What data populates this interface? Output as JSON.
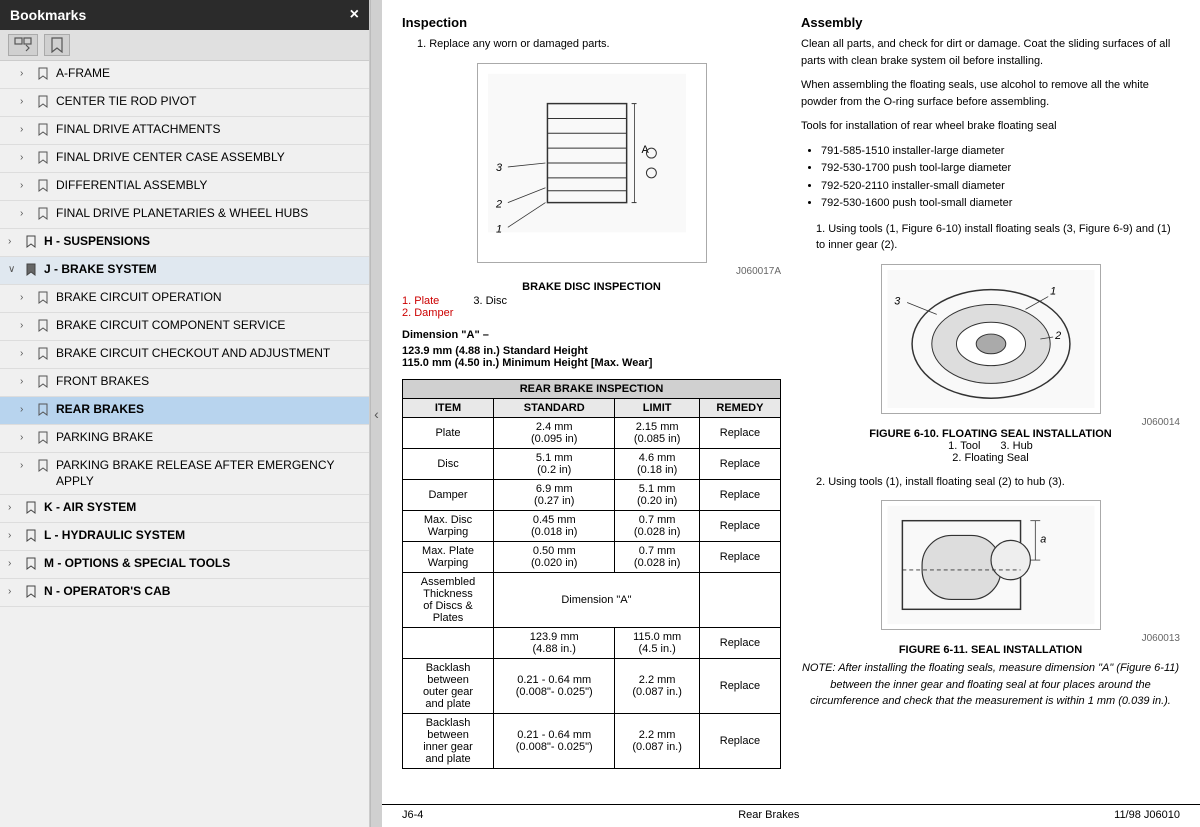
{
  "sidebar": {
    "title": "Bookmarks",
    "close_label": "×",
    "toolbar": {
      "btn1": "▤▼",
      "btn2": "🔖"
    },
    "items": [
      {
        "id": "a-frame",
        "label": "A-FRAME",
        "level": 1,
        "indent": 1,
        "expanded": false,
        "selected": false,
        "hasArrow": true
      },
      {
        "id": "center-tie-rod",
        "label": "CENTER TIE ROD PIVOT",
        "level": 1,
        "indent": 1,
        "expanded": false,
        "selected": false,
        "hasArrow": true
      },
      {
        "id": "final-drive-attach",
        "label": "FINAL DRIVE ATTACHMENTS",
        "level": 1,
        "indent": 1,
        "expanded": false,
        "selected": false,
        "hasArrow": true
      },
      {
        "id": "final-drive-center",
        "label": "FINAL DRIVE CENTER CASE ASSEMBLY",
        "level": 1,
        "indent": 1,
        "expanded": false,
        "selected": false,
        "hasArrow": true
      },
      {
        "id": "differential",
        "label": "DIFFERENTIAL ASSEMBLY",
        "level": 1,
        "indent": 1,
        "expanded": false,
        "selected": false,
        "hasArrow": true
      },
      {
        "id": "final-drive-planetaries",
        "label": "FINAL DRIVE PLANETARIES & WHEEL HUBS",
        "level": 1,
        "indent": 1,
        "expanded": false,
        "selected": false,
        "hasArrow": true
      },
      {
        "id": "h-suspensions",
        "label": "H - SUSPENSIONS",
        "level": 0,
        "indent": 0,
        "expanded": false,
        "selected": false,
        "hasArrow": true
      },
      {
        "id": "j-brake-system",
        "label": "J - BRAKE SYSTEM",
        "level": 0,
        "indent": 0,
        "expanded": true,
        "selected": false,
        "hasArrow": true,
        "isExpanded": true
      },
      {
        "id": "brake-circuit-op",
        "label": "BRAKE CIRCUIT OPERATION",
        "level": 1,
        "indent": 1,
        "expanded": false,
        "selected": false,
        "hasArrow": true
      },
      {
        "id": "brake-circuit-comp",
        "label": "BRAKE CIRCUIT COMPONENT SERVICE",
        "level": 1,
        "indent": 1,
        "expanded": false,
        "selected": false,
        "hasArrow": true
      },
      {
        "id": "brake-circuit-checkout",
        "label": "BRAKE CIRCUIT CHECKOUT AND ADJUSTMENT",
        "level": 1,
        "indent": 1,
        "expanded": false,
        "selected": false,
        "hasArrow": true
      },
      {
        "id": "front-brakes",
        "label": "FRONT BRAKES",
        "level": 1,
        "indent": 1,
        "expanded": false,
        "selected": false,
        "hasArrow": true
      },
      {
        "id": "rear-brakes",
        "label": "REAR BRAKES",
        "level": 1,
        "indent": 1,
        "expanded": false,
        "selected": true,
        "hasArrow": true
      },
      {
        "id": "parking-brake",
        "label": "PARKING BRAKE",
        "level": 1,
        "indent": 1,
        "expanded": false,
        "selected": false,
        "hasArrow": true
      },
      {
        "id": "parking-brake-release",
        "label": "PARKING BRAKE RELEASE AFTER EMERGENCY APPLY",
        "level": 1,
        "indent": 1,
        "expanded": false,
        "selected": false,
        "hasArrow": true
      },
      {
        "id": "k-air-system",
        "label": "K - AIR SYSTEM",
        "level": 0,
        "indent": 0,
        "expanded": false,
        "selected": false,
        "hasArrow": true
      },
      {
        "id": "l-hydraulic-system",
        "label": "L - HYDRAULIC SYSTEM",
        "level": 0,
        "indent": 0,
        "expanded": false,
        "selected": false,
        "hasArrow": true
      },
      {
        "id": "m-options",
        "label": "M - OPTIONS & SPECIAL TOOLS",
        "level": 0,
        "indent": 0,
        "expanded": false,
        "selected": false,
        "hasArrow": true
      },
      {
        "id": "n-operators-cab",
        "label": "N - OPERATOR'S CAB",
        "level": 0,
        "indent": 0,
        "expanded": false,
        "selected": false,
        "hasArrow": true
      }
    ]
  },
  "content": {
    "left_col": {
      "inspection": {
        "title": "Inspection",
        "item1": "Replace any worn or damaged parts.",
        "diagram_label": "J060017A",
        "caption_title": "BRAKE DISC INSPECTION",
        "caption_items": [
          "1. Plate",
          "2. Damper",
          "3. Disc",
          ""
        ],
        "dim_label": "Dimension \"A\" –",
        "dim_std": "123.9 mm (4.88 in.) Standard Height",
        "dim_min": "115.0 mm (4.50 in.) Minimum Height [Max. Wear]"
      },
      "table": {
        "title": "REAR BRAKE INSPECTION",
        "headers": [
          "ITEM",
          "STANDARD",
          "LIMIT",
          "REMEDY"
        ],
        "rows": [
          [
            "Plate",
            "2.4 mm\n(0.095 in)",
            "2.15 mm\n(0.085 in)",
            "Replace"
          ],
          [
            "Disc",
            "5.1 mm\n(0.2 in)",
            "4.6 mm\n(0.18 in)",
            "Replace"
          ],
          [
            "Damper",
            "6.9 mm\n(0.27 in)",
            "5.1 mm\n(0.20 in)",
            "Replace"
          ],
          [
            "Max. Disc\nWarping",
            "0.45 mm\n(0.018 in)",
            "0.7 mm\n(0.028 in)",
            "Replace"
          ],
          [
            "Max. Plate\nWarping",
            "0.50 mm\n(0.020 in)",
            "0.7 mm\n(0.028 in)",
            "Replace"
          ],
          [
            "Assembled\nThickness\nof Discs &\nPlates",
            "Dimension \"A\"",
            "",
            ""
          ],
          [
            "",
            "123.9 mm\n(4.88 in.)",
            "115.0 mm\n(4.5 in.)",
            "Replace"
          ],
          [
            "Backlash\nbetween\nouter gear\nand plate",
            "0.21 - 0.64 mm\n(0.008\"- 0.025\")",
            "2.2 mm\n(0.087 in.)",
            "Replace"
          ],
          [
            "Backlash\nbetween\ninner gear\nand plate",
            "0.21 - 0.64 mm\n(0.008\"- 0.025\")",
            "2.2 mm\n(0.087 in.)",
            "Replace"
          ]
        ]
      }
    },
    "right_col": {
      "assembly": {
        "title": "Assembly",
        "para1": "Clean all parts, and check for dirt or damage. Coat the sliding surfaces of all parts with clean brake system oil before installing.",
        "para2": "When assembling the floating seals, use alcohol to remove all the white powder from the O-ring surface before assembling.",
        "para3": "Tools for installation of rear wheel brake floating seal",
        "bullets": [
          "791-585-1510 installer-large diameter",
          "792-530-1700 push tool-large diameter",
          "792-520-2110 installer-small diameter",
          "792-530-1600 push tool-small diameter"
        ],
        "step1": "1. Using tools (1, Figure 6-10) install floating seals (3, Figure 6-9) and (1) to inner gear (2).",
        "fig10_label": "J060014",
        "fig10_caption": "FIGURE 6-10. FLOATING SEAL INSTALLATION",
        "fig10_items": [
          "1. Tool",
          "2. Floating Seal",
          "3. Hub"
        ],
        "step2": "2. Using tools (1), install floating seal (2) to hub (3).",
        "fig11_label": "J060013",
        "fig11_caption": "FIGURE 6-11. SEAL INSTALLATION",
        "fig11_note": "NOTE: After installing the floating seals, measure dimension \"A\" (Figure 6-11) between the inner gear and floating seal at four places around the circumference and check that the measurement is within 1 mm (0.039 in.)."
      }
    },
    "footer": {
      "left": "J6-4",
      "center": "Rear Brakes",
      "right": "11/98  J06010"
    }
  }
}
